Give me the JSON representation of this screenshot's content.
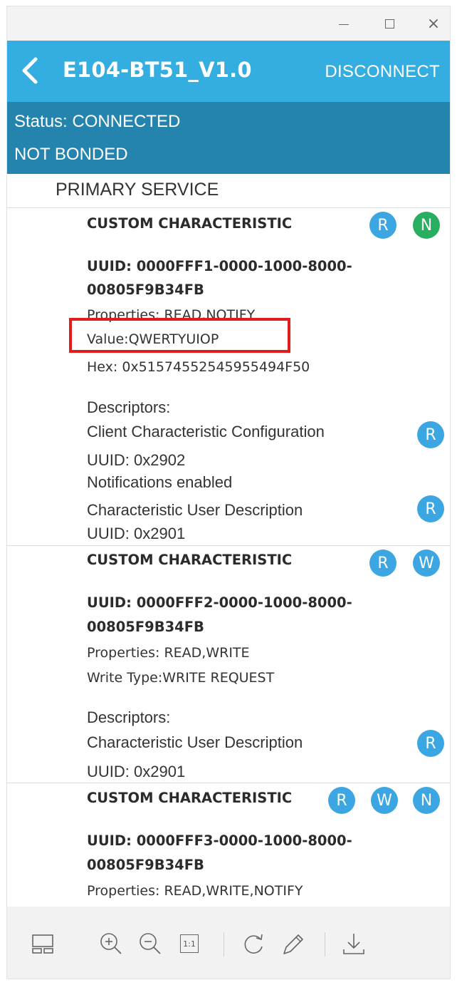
{
  "window": {
    "minimize_icon": "minimize-icon",
    "maximize_icon": "maximize-icon",
    "close_glyph": "×"
  },
  "appbar": {
    "back_icon": "chevron-left-icon",
    "title": "E104-BT51_V1.0",
    "disconnect_label": "DISCONNECT",
    "color": "#34ade0"
  },
  "status": {
    "connection": "Status: CONNECTED",
    "bond": "NOT BONDED",
    "color": "#2484ae"
  },
  "service": {
    "label": "PRIMARY SERVICE"
  },
  "characteristics": [
    {
      "name": "CUSTOM CHARACTERISTIC",
      "uuid_line1": "UUID: 0000FFF1-0000-1000-8000-",
      "uuid_line2": "00805F9B34FB",
      "properties": "Properties: READ,NOTIFY",
      "value": "Value:QWERTYUIOP",
      "hex": "Hex: 0x51574552545955494F50",
      "badges": [
        "R",
        "N"
      ],
      "descriptors_label": "Descriptors:",
      "descriptors": [
        {
          "name": "Client Characteristic Configuration",
          "uuid": "UUID: 0x2902",
          "extra": "Notifications enabled",
          "badge": "R"
        },
        {
          "name": "Characteristic User Description",
          "uuid": "UUID: 0x2901",
          "badge": "R"
        }
      ]
    },
    {
      "name": "CUSTOM CHARACTERISTIC",
      "uuid_line1": "UUID: 0000FFF2-0000-1000-8000-",
      "uuid_line2": "00805F9B34FB",
      "properties": "Properties: READ,WRITE",
      "write_type": "Write Type:WRITE REQUEST",
      "badges": [
        "R",
        "W"
      ],
      "descriptors_label": "Descriptors:",
      "descriptors": [
        {
          "name": "Characteristic User Description",
          "uuid": "UUID: 0x2901",
          "badge": "R"
        }
      ]
    },
    {
      "name": "CUSTOM CHARACTERISTIC",
      "uuid_line1": "UUID: 0000FFF3-0000-1000-8000-",
      "uuid_line2": "00805F9B34FB",
      "properties": "Properties: READ,WRITE,NOTIFY",
      "badges": [
        "R",
        "W",
        "N"
      ]
    }
  ],
  "badge_colors": {
    "read": "#3ba6e1",
    "write": "#3ba6e1",
    "notify_primary": "#27ae60",
    "notify_secondary": "#3ba6e1"
  },
  "highlight": {
    "color": "#e21b1b"
  },
  "toolbar": {
    "icons": [
      "layout-icon",
      "zoom-in-icon",
      "zoom-out-icon",
      "actual-size-icon",
      "rotate-icon",
      "edit-pen-icon",
      "download-icon"
    ],
    "actual_size_label": "1:1"
  }
}
